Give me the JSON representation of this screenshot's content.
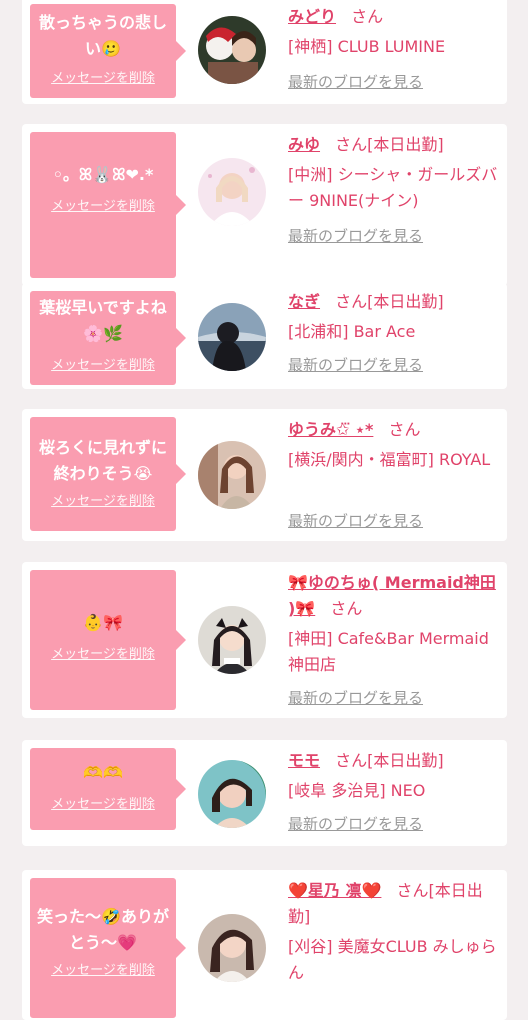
{
  "colors": {
    "page_background": "#f3eff0",
    "card_background": "#ffffff",
    "bubble_pink": "#fa9db0",
    "name_pink": "#e0436a",
    "link_gray": "#999999"
  },
  "common": {
    "delete_label": "メッセージを削除",
    "blog_label": "最新のブログを見る",
    "san_label": "さん"
  },
  "cards": [
    {
      "message_line1": "散っちゃうの悲し",
      "message_line2": "い🥲",
      "name": "みどり",
      "badge": "",
      "shop": "[神栖] CLUB LUMINE"
    },
    {
      "message_line1": "◦。ꕤ🐰ꕤ❤︎.*",
      "message_line2": "",
      "name": "みゆ",
      "badge": "[本日出勤]",
      "shop": "[中洲] シーシャ・ガールズバー 9NINE(ナイン)"
    },
    {
      "message_line1": "葉桜早いですよね",
      "message_line2": "🌸🌿",
      "name": "なぎ",
      "badge": "[本日出勤]",
      "shop": "[北浦和] Bar Ace"
    },
    {
      "message_line1": "桜ろくに見れずに",
      "message_line2": "終わりそう😭",
      "name": "ゆうみ✩⃛ ⋆*",
      "badge": "",
      "shop": "[横浜/関内・福富町] ROYAL"
    },
    {
      "message_line1": "👶🎀",
      "message_line2": "",
      "name": "🎀ゆのちゅ( Mermaid神田 )🎀",
      "badge": "",
      "shop": "[神田] Cafe&Bar Mermaid 神田店"
    },
    {
      "message_line1": "🫶🫶",
      "message_line2": "",
      "name": "モモ",
      "badge": "[本日出勤]",
      "shop": "[岐阜 多治見] NEO"
    },
    {
      "message_line1": "笑った〜🤣ありが",
      "message_line2": "とう〜💗",
      "name": "❤️星乃 凛❤️",
      "badge": "[本日出勤]",
      "shop": "[刈谷] 美魔女CLUB みしゅらん"
    }
  ]
}
